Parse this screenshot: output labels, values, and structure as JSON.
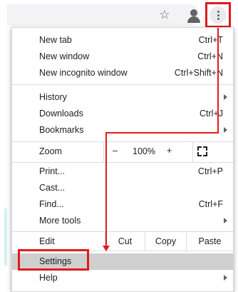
{
  "toolbar": {
    "icons": [
      "star-icon",
      "avatar-icon",
      "kebab-menu-icon"
    ]
  },
  "menu": {
    "new_tab": {
      "label": "New tab",
      "shortcut": "Ctrl+T"
    },
    "new_window": {
      "label": "New window",
      "shortcut": "Ctrl+N"
    },
    "new_incognito": {
      "label": "New incognito window",
      "shortcut": "Ctrl+Shift+N"
    },
    "history": {
      "label": "History"
    },
    "downloads": {
      "label": "Downloads",
      "shortcut": "Ctrl+J"
    },
    "bookmarks": {
      "label": "Bookmarks"
    },
    "zoom": {
      "label": "Zoom",
      "minus": "–",
      "value": "100%",
      "plus": "+"
    },
    "print": {
      "label": "Print...",
      "shortcut": "Ctrl+P"
    },
    "cast": {
      "label": "Cast..."
    },
    "find": {
      "label": "Find...",
      "shortcut": "Ctrl+F"
    },
    "more_tools": {
      "label": "More tools"
    },
    "edit": {
      "label": "Edit",
      "cut": "Cut",
      "copy": "Copy",
      "paste": "Paste"
    },
    "settings": {
      "label": "Settings"
    },
    "help": {
      "label": "Help"
    }
  },
  "colors": {
    "annotation": "#e01b1b",
    "hover_bg": "#cfcfcf"
  }
}
